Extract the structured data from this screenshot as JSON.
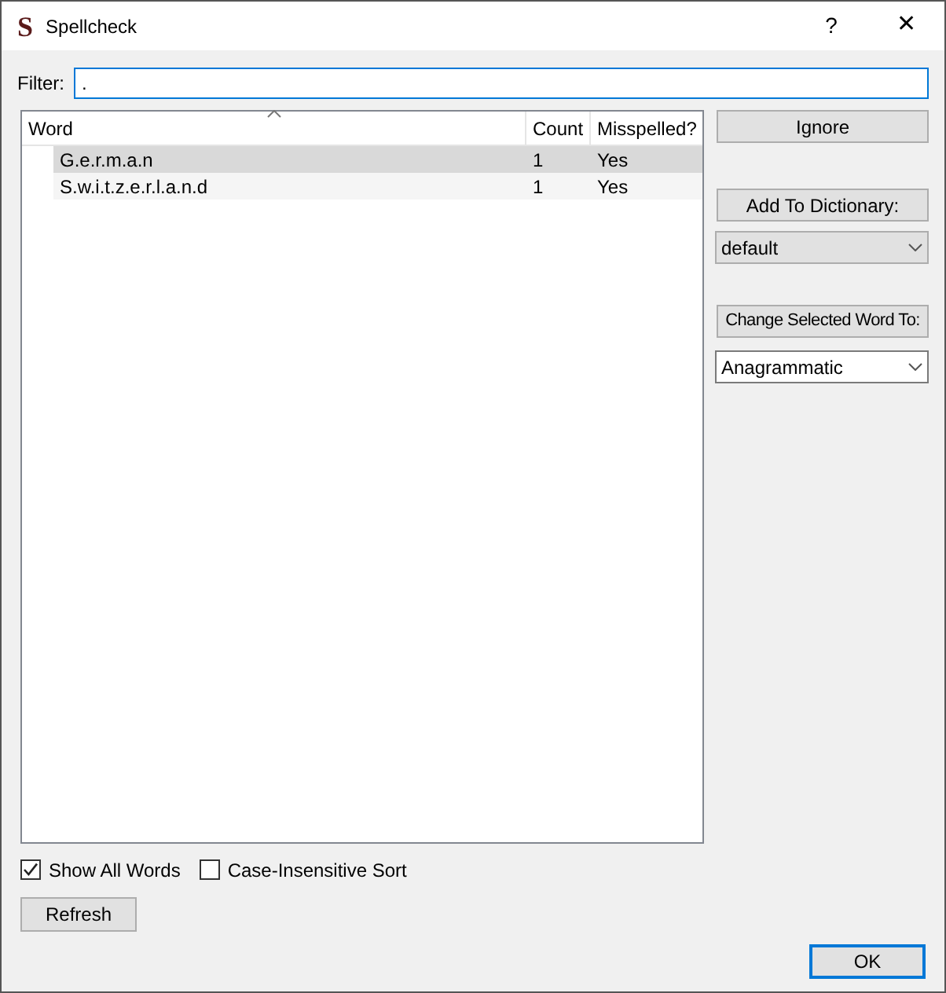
{
  "window": {
    "logo": "S",
    "title": "Spellcheck",
    "help": "?",
    "close": "✕"
  },
  "filter": {
    "label": "Filter:",
    "value": "."
  },
  "table": {
    "columns": [
      "Word",
      "Count",
      "Misspelled?"
    ],
    "rows": [
      {
        "word": "G.e.r.m.a.n",
        "count": "1",
        "misspelled": "Yes",
        "selected": true
      },
      {
        "word": "S.w.i.t.z.e.r.l.a.n.d",
        "count": "1",
        "misspelled": "Yes",
        "selected": false
      }
    ]
  },
  "actions": {
    "ignore": "Ignore",
    "add": "Add To Dictionary:",
    "dictionary": "default",
    "change": "Change Selected Word To:",
    "replacement": "Anagrammatic"
  },
  "options": [
    {
      "label": "Show All Words",
      "checked": true
    },
    {
      "label": "Case-Insensitive Sort",
      "checked": false
    }
  ],
  "buttons": {
    "refresh": "Refresh",
    "ok": "OK"
  }
}
